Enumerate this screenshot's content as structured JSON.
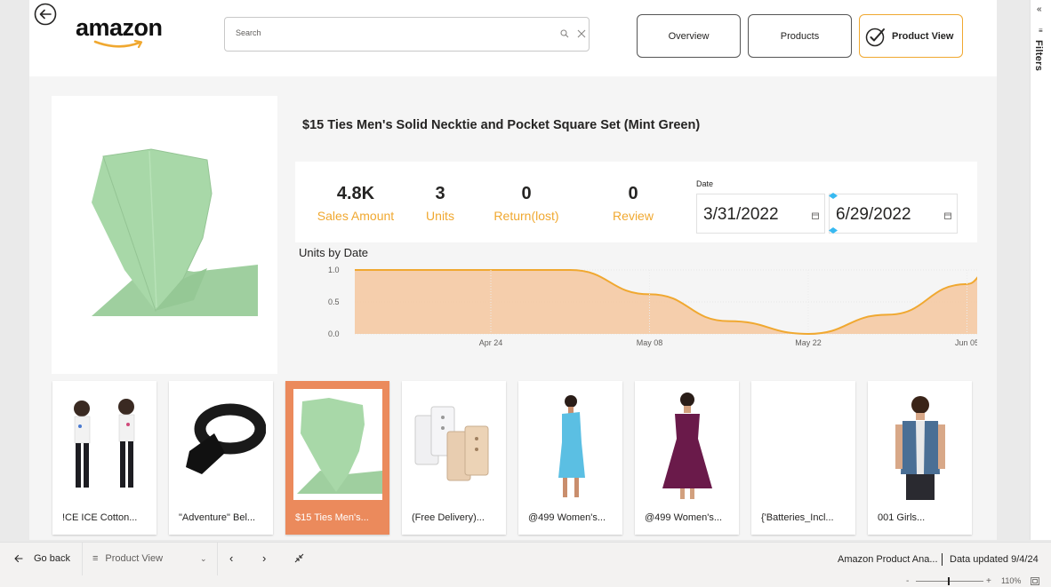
{
  "header": {
    "logo_text": "amazon",
    "search_placeholder": "Search",
    "nav_overview": "Overview",
    "nav_products": "Products",
    "nav_product_view": "Product View"
  },
  "product": {
    "title": "$15 Ties Men's Solid Necktie and Pocket Square Set (Mint Green)"
  },
  "kpis": {
    "sales_value": "4.8K",
    "sales_label": "Sales Amount",
    "units_value": "3",
    "units_label": "Units",
    "return_value": "0",
    "return_label": "Return(lost)",
    "review_value": "0",
    "review_label": "Review"
  },
  "date_slicer": {
    "label": "Date",
    "start": "3/31/2022",
    "end": "6/29/2022"
  },
  "chart_data": {
    "type": "area",
    "title": "Units by Date",
    "x": [
      "2022-04-12",
      "2022-04-24",
      "2022-05-01",
      "2022-05-08",
      "2022-05-15",
      "2022-05-22",
      "2022-05-29",
      "2022-06-05",
      "2022-06-07"
    ],
    "values": [
      1.0,
      1.0,
      1.0,
      0.62,
      0.2,
      0.0,
      0.3,
      0.78,
      1.0
    ],
    "x_ticks": [
      "Apr 24",
      "May 08",
      "May 22",
      "Jun 05"
    ],
    "y_ticks": [
      "1.0",
      "0.5",
      "0.0"
    ],
    "ylim": [
      0,
      1
    ],
    "grid": true,
    "colors": {
      "line": "#f0a830",
      "fill": "#f5c79f"
    }
  },
  "gallery": {
    "items": [
      {
        "label": "!CE ICE Cotton...",
        "icon": "girls-clothing-photo",
        "selected": false
      },
      {
        "label": "\"Adventure\" Bel...",
        "icon": "belt-photo",
        "selected": false
      },
      {
        "label": "$15 Ties Men's...",
        "icon": "necktie-photo",
        "selected": true
      },
      {
        "label": "(Free Delivery)...",
        "icon": "bra-extender-photo",
        "selected": false
      },
      {
        "label": "@499 Women's...",
        "icon": "blue-dress-photo",
        "selected": false
      },
      {
        "label": "@499 Women's...",
        "icon": "purple-dress-photo",
        "selected": false
      },
      {
        "label": "{'Batteries_Incl...",
        "icon": "blank-photo",
        "selected": false
      },
      {
        "label": "001 Girls...",
        "icon": "denim-vest-photo",
        "selected": false
      }
    ]
  },
  "filters_pane": {
    "label": "Filters"
  },
  "footer": {
    "go_back": "Go back",
    "page": "Product View",
    "report_name": "Amazon Product Ana...",
    "data_updated": "Data updated 9/4/24",
    "zoom": "110%"
  },
  "colors": {
    "accent": "#f0a830",
    "selected_tile": "#eb8a5c",
    "tie": "#a8d8a8"
  }
}
